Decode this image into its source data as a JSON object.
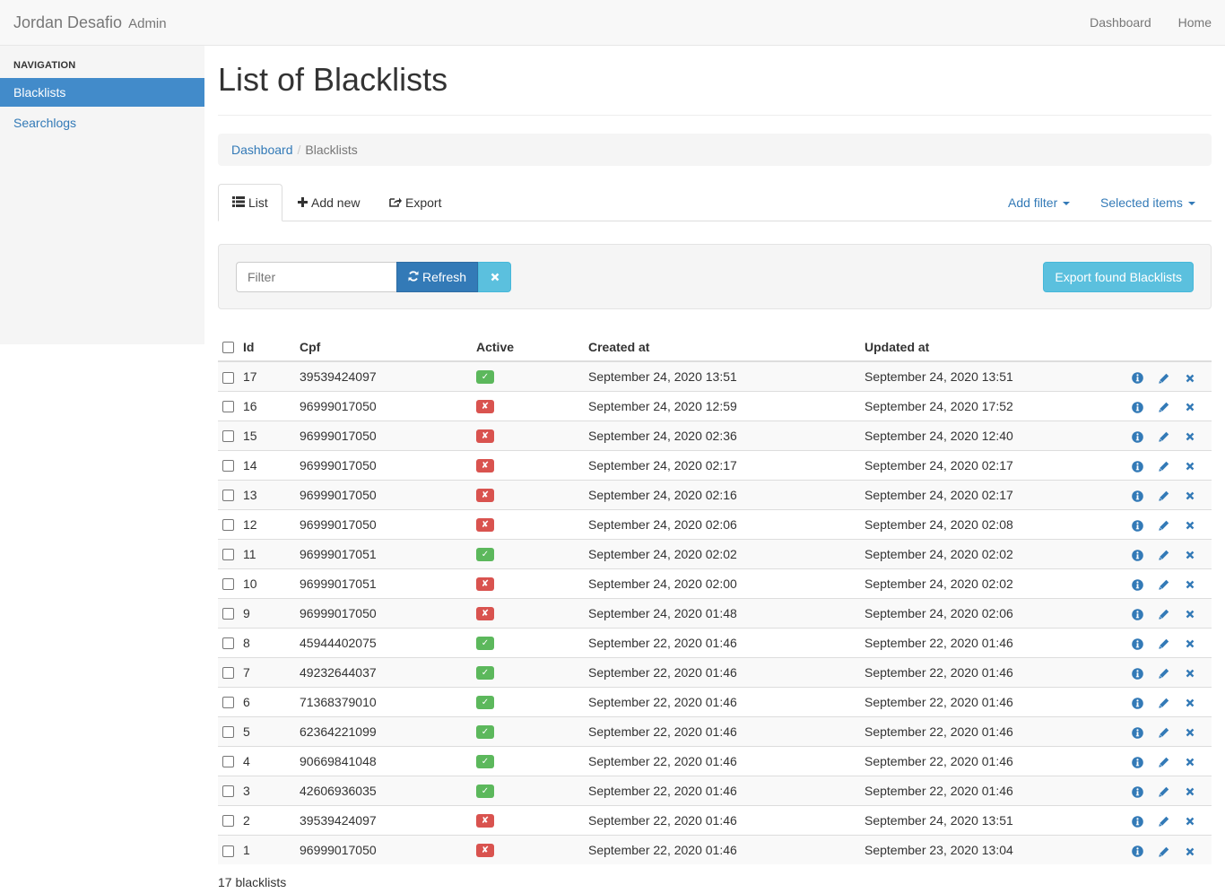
{
  "navbar": {
    "brand": "Jordan Desafio",
    "brand_sub": "Admin",
    "links": [
      "Dashboard",
      "Home"
    ]
  },
  "sidebar": {
    "header": "NAVIGATION",
    "items": [
      {
        "label": "Blacklists",
        "active": true
      },
      {
        "label": "Searchlogs",
        "active": false
      }
    ]
  },
  "page": {
    "title": "List of Blacklists",
    "breadcrumb": {
      "link": "Dashboard",
      "current": "Blacklists"
    }
  },
  "tabs": {
    "list": "List",
    "add_new": "Add new",
    "export": "Export",
    "add_filter": "Add filter",
    "selected_items": "Selected items"
  },
  "filter": {
    "placeholder": "Filter",
    "refresh": "Refresh",
    "export_found": "Export found Blacklists"
  },
  "table": {
    "headers": {
      "id": "Id",
      "cpf": "Cpf",
      "active": "Active",
      "created_at": "Created at",
      "updated_at": "Updated at"
    },
    "rows": [
      {
        "id": "17",
        "cpf": "39539424097",
        "active": true,
        "created_at": "September 24, 2020 13:51",
        "updated_at": "September 24, 2020 13:51"
      },
      {
        "id": "16",
        "cpf": "96999017050",
        "active": false,
        "created_at": "September 24, 2020 12:59",
        "updated_at": "September 24, 2020 17:52"
      },
      {
        "id": "15",
        "cpf": "96999017050",
        "active": false,
        "created_at": "September 24, 2020 02:36",
        "updated_at": "September 24, 2020 12:40"
      },
      {
        "id": "14",
        "cpf": "96999017050",
        "active": false,
        "created_at": "September 24, 2020 02:17",
        "updated_at": "September 24, 2020 02:17"
      },
      {
        "id": "13",
        "cpf": "96999017050",
        "active": false,
        "created_at": "September 24, 2020 02:16",
        "updated_at": "September 24, 2020 02:17"
      },
      {
        "id": "12",
        "cpf": "96999017050",
        "active": false,
        "created_at": "September 24, 2020 02:06",
        "updated_at": "September 24, 2020 02:08"
      },
      {
        "id": "11",
        "cpf": "96999017051",
        "active": true,
        "created_at": "September 24, 2020 02:02",
        "updated_at": "September 24, 2020 02:02"
      },
      {
        "id": "10",
        "cpf": "96999017051",
        "active": false,
        "created_at": "September 24, 2020 02:00",
        "updated_at": "September 24, 2020 02:02"
      },
      {
        "id": "9",
        "cpf": "96999017050",
        "active": false,
        "created_at": "September 24, 2020 01:48",
        "updated_at": "September 24, 2020 02:06"
      },
      {
        "id": "8",
        "cpf": "45944402075",
        "active": true,
        "created_at": "September 22, 2020 01:46",
        "updated_at": "September 22, 2020 01:46"
      },
      {
        "id": "7",
        "cpf": "49232644037",
        "active": true,
        "created_at": "September 22, 2020 01:46",
        "updated_at": "September 22, 2020 01:46"
      },
      {
        "id": "6",
        "cpf": "71368379010",
        "active": true,
        "created_at": "September 22, 2020 01:46",
        "updated_at": "September 22, 2020 01:46"
      },
      {
        "id": "5",
        "cpf": "62364221099",
        "active": true,
        "created_at": "September 22, 2020 01:46",
        "updated_at": "September 22, 2020 01:46"
      },
      {
        "id": "4",
        "cpf": "90669841048",
        "active": true,
        "created_at": "September 22, 2020 01:46",
        "updated_at": "September 22, 2020 01:46"
      },
      {
        "id": "3",
        "cpf": "42606936035",
        "active": true,
        "created_at": "September 22, 2020 01:46",
        "updated_at": "September 22, 2020 01:46"
      },
      {
        "id": "2",
        "cpf": "39539424097",
        "active": false,
        "created_at": "September 22, 2020 01:46",
        "updated_at": "September 24, 2020 13:51"
      },
      {
        "id": "1",
        "cpf": "96999017050",
        "active": false,
        "created_at": "September 22, 2020 01:46",
        "updated_at": "September 23, 2020 13:04"
      }
    ]
  },
  "footer": {
    "count": "17 blacklists"
  },
  "icons": {
    "list_tab": "list-icon",
    "add_new_tab": "plus-icon",
    "export_tab": "share-icon",
    "refresh": "refresh-icon",
    "clear": "close-icon",
    "active_yes": "check-icon",
    "active_no": "cross-icon",
    "row_show": "info-icon",
    "row_edit": "pencil-icon",
    "row_delete": "close-icon"
  },
  "colors": {
    "primary": "#337ab7",
    "sidebar_active": "#428bca",
    "info": "#5bc0de",
    "success": "#5cb85c",
    "danger": "#d9534f"
  }
}
